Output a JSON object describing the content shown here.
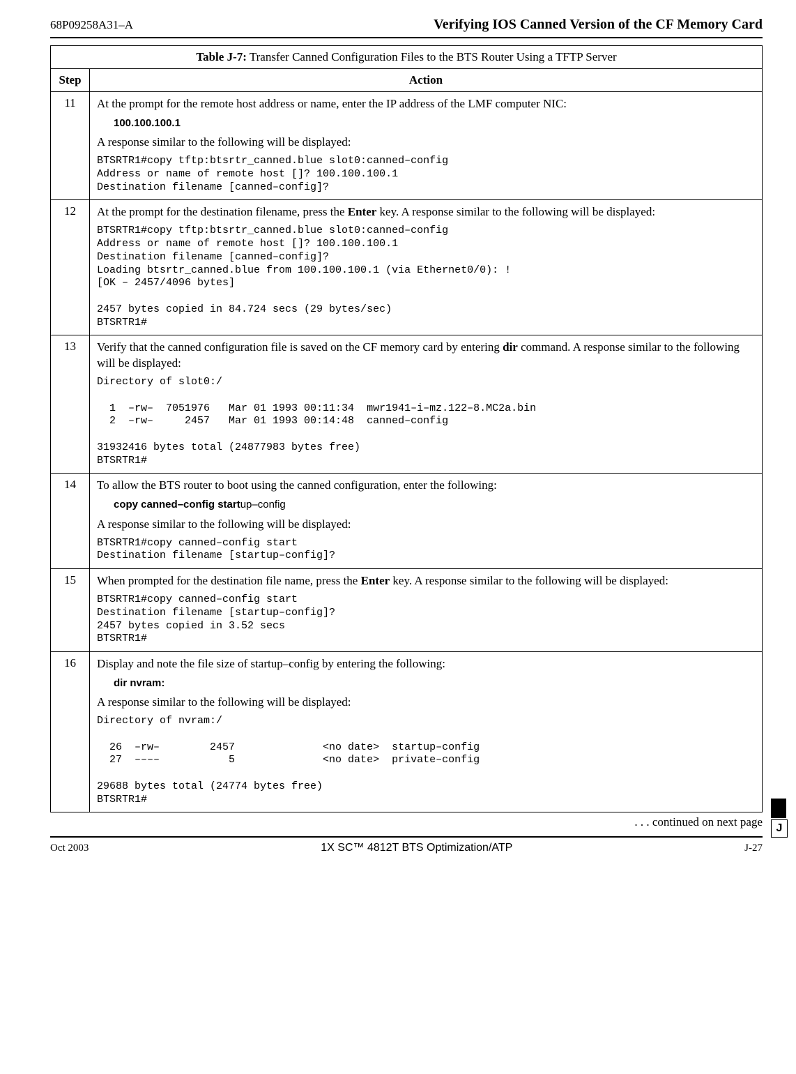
{
  "header": {
    "doc_id": "68P09258A31–A",
    "title": "Verifying IOS Canned Version of the CF Memory Card"
  },
  "table": {
    "label": "Table J-7:",
    "caption": "Transfer Canned Configuration Files to the BTS Router Using a TFTP Server",
    "col_step": "Step",
    "col_action": "Action"
  },
  "rows": [
    {
      "step": "11",
      "para1": "At the prompt for the remote host address or name, enter the IP address of the LMF computer NIC:",
      "cmd": "100.100.100.1",
      "para2": "A response similar to the following will be displayed:",
      "code": "BTSRTR1#copy tftp:btsrtr_canned.blue slot0:canned–config\nAddress or name of remote host []? 100.100.100.1\nDestination filename [canned–config]?"
    },
    {
      "step": "12",
      "para1_pre": "At the prompt for the destination filename, press the ",
      "para1_bold": "Enter",
      "para1_post": " key. A response similar to the following will be displayed:",
      "code": "BTSRTR1#copy tftp:btsrtr_canned.blue slot0:canned–config\nAddress or name of remote host []? 100.100.100.1\nDestination filename [canned–config]?\nLoading btsrtr_canned.blue from 100.100.100.1 (via Ethernet0/0): !\n[OK – 2457/4096 bytes]\n\n2457 bytes copied in 84.724 secs (29 bytes/sec)\nBTSRTR1#"
    },
    {
      "step": "13",
      "para1_pre": "Verify that the canned configuration file is saved on the CF memory card by entering ",
      "para1_bold": "dir",
      "para1_post": " command.  A response similar to the following will be displayed:",
      "code": "Directory of slot0:/\n\n  1  –rw–  7051976   Mar 01 1993 00:11:34  mwr1941–i–mz.122–8.MC2a.bin\n  2  –rw–     2457   Mar 01 1993 00:14:48  canned–config\n\n31932416 bytes total (24877983 bytes free)\nBTSRTR1#"
    },
    {
      "step": "14",
      "para1": "To allow the BTS router to boot using the canned configuration, enter the following:",
      "cmd_bold": "copy canned–config  start",
      "cmd_light": "up–config",
      "para2": "A response similar to the following will be displayed:",
      "code": "BTSRTR1#copy canned–config start\nDestination filename [startup–config]?"
    },
    {
      "step": "15",
      "para1_pre": "When prompted for the destination file name, press the ",
      "para1_bold": "Enter",
      "para1_post": " key. A response similar to the following will be displayed:",
      "code": "BTSRTR1#copy canned–config start\nDestination filename [startup–config]?\n2457 bytes copied in 3.52 secs\nBTSRTR1#"
    },
    {
      "step": "16",
      "para1": "Display and note the file size of startup–config by entering the following:",
      "cmd": "dir  nvram:",
      "para2": "A response similar to the following will be displayed:",
      "code": "Directory of nvram:/\n\n  26  –rw–        2457              <no date>  startup–config\n  27  ––––           5              <no date>  private–config\n\n29688 bytes total (24774 bytes free)\nBTSRTR1#"
    }
  ],
  "continued": " . . . continued on next page",
  "footer": {
    "left": "Oct 2003",
    "center": "1X SC™ 4812T BTS Optimization/ATP",
    "right": "J-27"
  },
  "side_letter": "J"
}
